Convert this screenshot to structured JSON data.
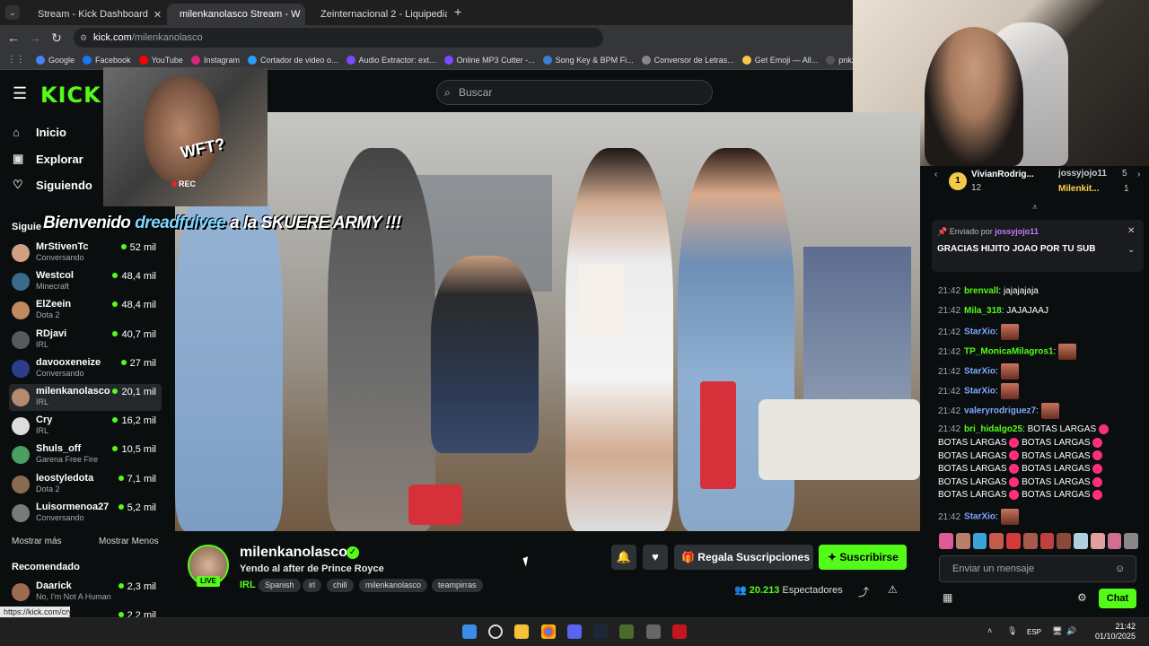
{
  "browser": {
    "tabs": [
      {
        "label": "Stream - Kick Dashboard",
        "active": false
      },
      {
        "label": "milenkanolasco Stream - W",
        "active": true
      },
      {
        "label": "Zeinternacional 2 - Liquipedia",
        "active": false
      }
    ],
    "new_tab": "+",
    "url_host": "kick.com",
    "url_path": "/milenkanolasco",
    "bookmarks": [
      "Google",
      "Facebook",
      "YouTube",
      "Instagram",
      "Cortador de video o...",
      "Audio Extractor: ext...",
      "Online MP3 Cutter -...",
      "Song Key & BPM Fi...",
      "Conversor de Letras...",
      "Get Emoji — All...",
      "pnkz_Oficial - T"
    ],
    "status_url": "https://kick.com/cry"
  },
  "kick": {
    "logo": "KICK",
    "search_placeholder": "Buscar",
    "nav": [
      {
        "label": "Inicio",
        "icon": "home-icon"
      },
      {
        "label": "Explorar",
        "icon": "compass-icon"
      },
      {
        "label": "Siguiendo",
        "icon": "heart-icon"
      }
    ],
    "following_header": "Siguie",
    "channels": [
      {
        "name": "MrStivenTc",
        "category": "Conversando",
        "viewers": "52 mil",
        "color": "#d0a080"
      },
      {
        "name": "Westcol",
        "category": "Minecraft",
        "viewers": "48,4 mil",
        "color": "#3a6b8a"
      },
      {
        "name": "ElZeein",
        "category": "Dota 2",
        "viewers": "48,4 mil",
        "color": "#c08a60"
      },
      {
        "name": "RDjavi",
        "category": "IRL",
        "viewers": "40,7 mil",
        "color": "#555a60"
      },
      {
        "name": "davooxeneize",
        "category": "Conversando",
        "viewers": "27 mil",
        "color": "#2c3e8a"
      },
      {
        "name": "milenkanolasco",
        "category": "IRL",
        "viewers": "20,1 mil",
        "color": "#b58b70"
      },
      {
        "name": "Cry",
        "category": "IRL",
        "viewers": "16,2 mil",
        "color": "#dddddd"
      },
      {
        "name": "Shuls_off",
        "category": "Garena Free Fire",
        "viewers": "10,5 mil",
        "color": "#4aa060"
      },
      {
        "name": "leostyledota",
        "category": "Dota 2",
        "viewers": "7,1 mil",
        "color": "#8a6a50"
      },
      {
        "name": "Luisormenoa27",
        "category": "Conversando",
        "viewers": "5,2 mil",
        "color": "#7a7a7a"
      }
    ],
    "show_more": "Mostrar más",
    "show_less": "Mostrar Menos",
    "recommended_header": "Recomendado",
    "recommended": [
      {
        "name": "Daarick",
        "category": "No, I'm Not A Human",
        "viewers": "2,3 mil",
        "color": "#a06a50"
      },
      {
        "name": "tine",
        "category": "",
        "viewers": "2,2 mil",
        "color": "#666"
      }
    ]
  },
  "overlay": {
    "clip_text": "WFT?",
    "rec": "REC",
    "welcome_prefix": "Bienvenido",
    "welcome_user": "dreadfulvee",
    "welcome_suffix": "a la SKUERE ARMY !!!"
  },
  "stream": {
    "live_badge": "LIVE",
    "channel": "milenkanolasco",
    "title": "Yendo al after de Prince Royce",
    "category": "IRL",
    "tags": [
      "Spanish",
      "irl",
      "chill",
      "milenkanolasco",
      "teampirras"
    ],
    "gift_label": "Regala Suscripciones",
    "subscribe_label": "Suscribirse",
    "viewer_count": "20.213",
    "viewers_label": "Espectadores"
  },
  "chat": {
    "leaderboard": [
      {
        "name": "VivianRodrig...",
        "value": "12"
      },
      {
        "name": "jossyjojo11",
        "value": "5"
      },
      {
        "name": "Milenkit...",
        "value": "1"
      }
    ],
    "pinned_by_label": "Enviado por",
    "pinned_by_user": "jossyjojo11",
    "pinned_message": "GRACIAS HIJITO JOAO POR TU SUB",
    "messages": [
      {
        "time": "21:42",
        "user": "brenvall",
        "color": "#53fc18",
        "text": "jajajajaja"
      },
      {
        "time": "21:42",
        "user": "Mila_318",
        "color": "#53fc18",
        "text": "JAJAJAAJ"
      },
      {
        "time": "21:42",
        "user": "StarXio",
        "color": "#7ea8ff",
        "text": ""
      },
      {
        "time": "21:42",
        "user": "TP_MonicaMilagros1",
        "color": "#53fc18",
        "text": ""
      },
      {
        "time": "21:42",
        "user": "StarXio",
        "color": "#7ea8ff",
        "text": ""
      },
      {
        "time": "21:42",
        "user": "StarXio",
        "color": "#7ea8ff",
        "text": ""
      },
      {
        "time": "21:42",
        "user": "valeryrodriguez7",
        "color": "#7ea8ff",
        "text": ""
      },
      {
        "time": "21:42",
        "user": "bri_hidalgo25",
        "color": "#53fc18",
        "text": "BOTAS LARGAS"
      },
      {
        "time": "21:42",
        "user": "StarXio",
        "color": "#7ea8ff",
        "text": ""
      }
    ],
    "botas": "BOTAS LARGAS",
    "input_placeholder": "Enviar un mensaje",
    "chat_button": "Chat"
  },
  "taskbar": {
    "lang": "ESP",
    "time": "21:42",
    "date": "01/10/2025"
  }
}
